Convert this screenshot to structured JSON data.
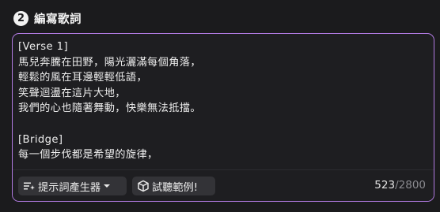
{
  "section": {
    "step_number": "2",
    "title": "編寫歌詞"
  },
  "lyrics": {
    "text": "[Verse 1]\n馬兒奔騰在田野，陽光灑滿每個角落，\n輕鬆的風在耳邊輕輕低語，\n笑聲迴盪在這片大地，\n我們的心也隨著舞動，快樂無法抵擋。\n\n[Bridge]\n每一個步伐都是希望的旋律，"
  },
  "toolbar": {
    "generator_label": "提示詞產生器",
    "demo_label": "試聽範例!",
    "char_count": "523",
    "separator": "/",
    "char_max": "2800"
  },
  "icons": {
    "generator": "sparkle-list-icon",
    "dropdown": "chevron-down-icon",
    "demo": "cube-icon"
  },
  "colors": {
    "accent_border": "#b07ae0",
    "background": "#1b1b1d",
    "button_bg": "#333337"
  }
}
